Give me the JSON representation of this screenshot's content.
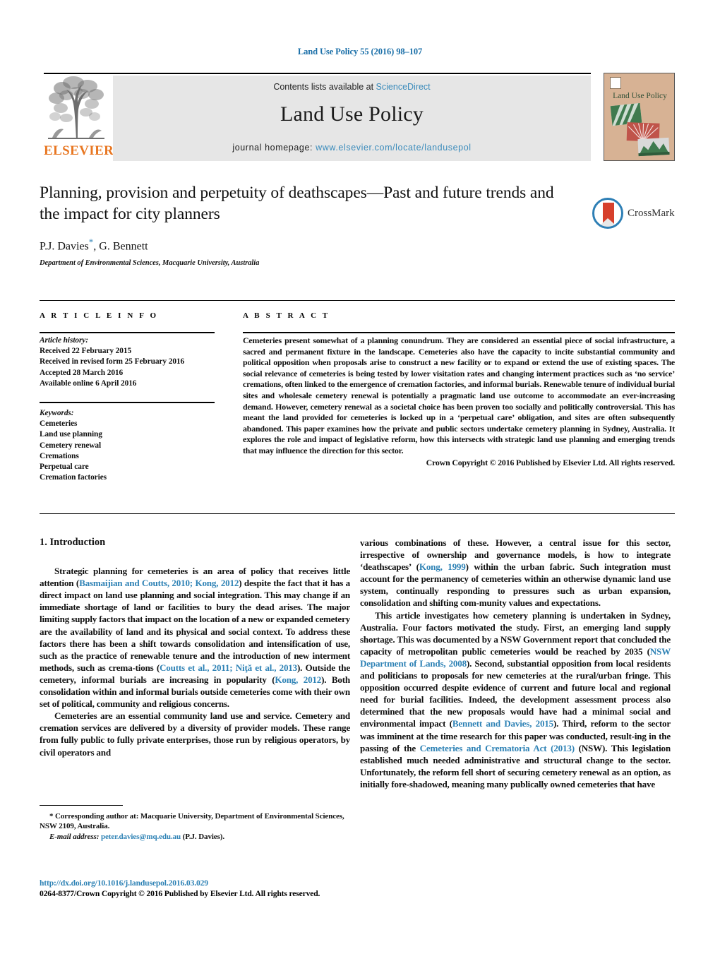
{
  "running_head": "Land Use Policy 55 (2016) 98–107",
  "masthead": {
    "contents_prefix": "Contents lists available at ",
    "sciencedirect": "ScienceDirect",
    "journal_name": "Land Use Policy",
    "homepage_prefix": "journal homepage: ",
    "homepage_url": "www.elsevier.com/locate/landusepol",
    "publisher": "ELSEVIER",
    "cover_title": "Land Use Policy",
    "accent_blue": "#3a8bbb",
    "elsevier_orange": "#e87722",
    "cover_bg": "#d7b294"
  },
  "article": {
    "title": "Planning, provision and perpetuity of deathscapes—Past and future trends and the impact for city planners",
    "authors": "P.J. Davies",
    "authors_rest": ", G. Bennett",
    "corresponding_marker": "*",
    "affiliation": "Department of Environmental Sciences, Macquarie University, Australia",
    "crossmark_label": "CrossMark"
  },
  "article_info": {
    "heading": "A R T I C L E    I N F O",
    "history_label": "Article history:",
    "history": [
      "Received 22 February 2015",
      "Received in revised form 25 February 2016",
      "Accepted 28 March 2016",
      "Available online 6 April 2016"
    ],
    "keywords_label": "Keywords:",
    "keywords": [
      "Cemeteries",
      "Land use planning",
      "Cemetery renewal",
      "Cremations",
      "Perpetual care",
      "Cremation factories"
    ]
  },
  "abstract": {
    "heading": "A B S T R A C T",
    "text": "Cemeteries present somewhat of a planning conundrum. They are considered an essential piece of social infrastructure, a sacred and permanent fixture in the landscape. Cemeteries also have the capacity to incite substantial community and political opposition when proposals arise to construct a new facility or to expand or extend the use of existing spaces. The social relevance of cemeteries is being tested by lower visitation rates and changing interment practices such as ‘no service’ cremations, often linked to the emergence of cremation factories, and informal burials. Renewable tenure of individual burial sites and wholesale cemetery renewal is potentially a pragmatic land use outcome to accommodate an ever-increasing demand. However, cemetery renewal as a societal choice has been proven too socially and politically controversial. This has meant the land provided for cemeteries is locked up in a ‘perpetual care’ obligation, and sites are often subsequently abandoned. This paper examines how the private and public sectors undertake cemetery planning in Sydney, Australia. It explores the role and impact of legislative reform, how this intersects with strategic land use planning and emerging trends that may influence the direction for this sector.",
    "copyright": "Crown Copyright © 2016 Published by Elsevier Ltd. All rights reserved."
  },
  "body": {
    "section_number_title": "1.  Introduction",
    "left_paragraphs": [
      {
        "parts": [
          {
            "t": "Strategic planning for cemeteries is an area of policy that receives little attention (",
            "link": false
          },
          {
            "t": "Basmaijian and Coutts, 2010; Kong, 2012",
            "link": true
          },
          {
            "t": ") despite the fact that it has a direct impact on land use planning and social integration. This may change if an immediate shortage of land or facilities to bury the dead arises. The major limiting supply factors that impact on the location of a new or expanded cemetery are the availability of land and its physical and social context. To address these factors there has been a shift towards consolidation and intensification of use, such as the practice of renewable tenure and the introduction of new interment methods, such as crema-tions (",
            "link": false
          },
          {
            "t": "Coutts et al., 2011; Niţă et al., 2013",
            "link": true
          },
          {
            "t": "). Outside the cemetery, informal burials are increasing in popularity (",
            "link": false
          },
          {
            "t": "Kong, 2012",
            "link": true
          },
          {
            "t": "). Both consolidation within and informal burials outside cemeteries come with their own set of political, community and religious concerns.",
            "link": false
          }
        ]
      },
      {
        "parts": [
          {
            "t": "Cemeteries are an essential community land use and service. Cemetery and cremation services are delivered by a diversity of provider models. These range from fully public to fully private enterprises, those run by religious operators, by civil operators and",
            "link": false
          }
        ]
      }
    ],
    "right_paragraphs": [
      {
        "parts": [
          {
            "t": "various combinations of these. However, a central issue for this sector, irrespective of ownership and governance models, is how to integrate ‘deathscapes’ (",
            "link": false
          },
          {
            "t": "Kong, 1999",
            "link": true
          },
          {
            "t": ") within the urban fabric. Such integration must account for the permanency of cemeteries within an otherwise dynamic land use system, continually responding to pressures such as urban expansion, consolidation and shifting com-munity values and expectations.",
            "link": false
          }
        ],
        "no_indent": true
      },
      {
        "parts": [
          {
            "t": "This article investigates how cemetery planning is undertaken in Sydney, Australia. Four factors motivated the study. First, an emerging land supply shortage. This was documented by a NSW Government report that concluded the capacity of metropolitan public cemeteries would be reached by 2035 (",
            "link": false
          },
          {
            "t": "NSW Department of Lands, 2008",
            "link": true
          },
          {
            "t": "). Second, substantial opposition from local residents and politicians to proposals for new cemeteries at the rural/urban fringe. This opposition occurred despite evidence of current and future local and regional need for burial facilities. Indeed, the development assessment process also determined that the new proposals would have had a minimal social and environmental impact (",
            "link": false
          },
          {
            "t": "Bennett and Davies, 2015",
            "link": true
          },
          {
            "t": "). Third, reform to the sector was imminent at the time research for this paper was conducted, result-ing in the passing of the ",
            "link": false
          },
          {
            "t": "Cemeteries and Crematoria Act (2013)",
            "link": true
          },
          {
            "t": " (NSW). This legislation established much needed administrative and structural change to the sector. Unfortunately, the reform fell short of securing cemetery renewal as an option, as initially fore-shadowed, meaning many publically owned cemeteries that have",
            "link": false
          }
        ]
      }
    ]
  },
  "footnotes": {
    "corresponding": "* Corresponding author at: Macquarie University, Department of Environmental Sciences, NSW 2109, Australia.",
    "email_label": "E-mail address:",
    "email": "peter.davies@mq.edu.au",
    "email_suffix": " (P.J. Davies).",
    "doi": "http://dx.doi.org/10.1016/j.landusepol.2016.03.029",
    "issn_line": "0264-8377/Crown Copyright © 2016 Published by Elsevier Ltd. All rights reserved."
  }
}
